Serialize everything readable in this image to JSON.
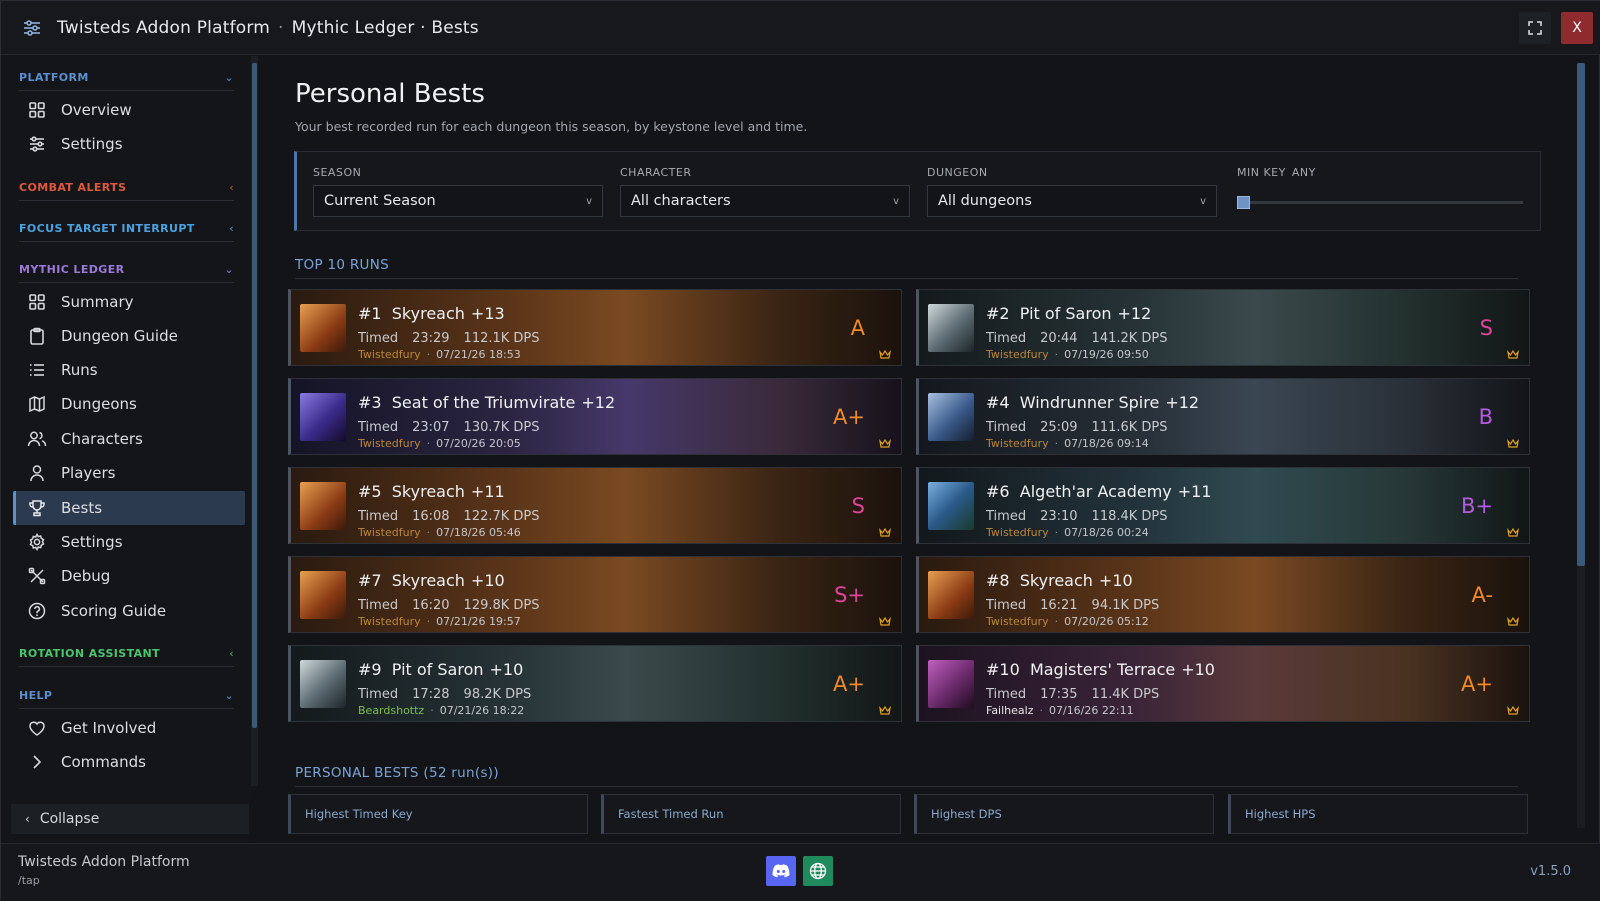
{
  "window": {
    "app_title": "Twisteds Addon Platform",
    "separator": "·",
    "section_title": "Mythic Ledger · Bests",
    "close_label": "X"
  },
  "sidebar": {
    "sections": [
      {
        "label": "PLATFORM",
        "color": "#5b8fcf",
        "expanded": true,
        "items": [
          "Overview",
          "Settings"
        ]
      },
      {
        "label": "COMBAT ALERTS",
        "color": "#e0583b",
        "expanded": false
      },
      {
        "label": "FOCUS TARGET INTERRUPT",
        "color": "#4aa3e0",
        "expanded": false
      },
      {
        "label": "MYTHIC LEDGER",
        "color": "#9b7ad8",
        "expanded": true,
        "items": [
          "Summary",
          "Dungeon Guide",
          "Runs",
          "Dungeons",
          "Characters",
          "Players",
          "Bests",
          "Settings",
          "Debug",
          "Scoring Guide"
        ]
      },
      {
        "label": "ROTATION ASSISTANT",
        "color": "#4cc46d",
        "expanded": false
      },
      {
        "label": "HELP",
        "color": "#5b8fcf",
        "expanded": true,
        "items": [
          "Get Involved",
          "Commands"
        ]
      }
    ],
    "active_item": "Bests",
    "collapse_label": "Collapse"
  },
  "page": {
    "title": "Personal Bests",
    "subtitle": "Your best recorded run for each dungeon this season, by keystone level and time."
  },
  "filters": {
    "season": {
      "label": "SEASON",
      "value": "Current Season"
    },
    "character": {
      "label": "CHARACTER",
      "value": "All characters"
    },
    "dungeon": {
      "label": "DUNGEON",
      "value": "All dungeons"
    },
    "min_key": {
      "label": "MIN KEY",
      "value": "ANY",
      "level": 0
    }
  },
  "top_runs": {
    "heading": "TOP 10 RUNS",
    "runs": [
      {
        "rank": "#1",
        "dungeon": "Skyreach",
        "level": "+13",
        "status": "Timed",
        "time": "23:29",
        "dps": "112.1K DPS",
        "player": "Twistedfury",
        "date": "07/21/26 18:53",
        "grade": "A",
        "grade_color": "#f08a2c",
        "theme": "skyreach"
      },
      {
        "rank": "#2",
        "dungeon": "Pit of Saron",
        "level": "+12",
        "status": "Timed",
        "time": "20:44",
        "dps": "141.2K DPS",
        "player": "Twistedfury",
        "date": "07/19/26 09:50",
        "grade": "S",
        "grade_color": "#e0449a",
        "theme": "saron"
      },
      {
        "rank": "#3",
        "dungeon": "Seat of the Triumvirate",
        "level": "+12",
        "status": "Timed",
        "time": "23:07",
        "dps": "130.7K DPS",
        "player": "Twistedfury",
        "date": "07/20/26 20:05",
        "grade": "A+",
        "grade_color": "#f08a2c",
        "theme": "seat"
      },
      {
        "rank": "#4",
        "dungeon": "Windrunner Spire",
        "level": "+12",
        "status": "Timed",
        "time": "25:09",
        "dps": "111.6K DPS",
        "player": "Twistedfury",
        "date": "07/18/26 09:14",
        "grade": "B",
        "grade_color": "#b45be0",
        "theme": "windrunner"
      },
      {
        "rank": "#5",
        "dungeon": "Skyreach",
        "level": "+11",
        "status": "Timed",
        "time": "16:08",
        "dps": "122.7K DPS",
        "player": "Twistedfury",
        "date": "07/18/26 05:46",
        "grade": "S",
        "grade_color": "#e0449a",
        "theme": "skyreach"
      },
      {
        "rank": "#6",
        "dungeon": "Algeth'ar Academy",
        "level": "+11",
        "status": "Timed",
        "time": "23:10",
        "dps": "118.4K DPS",
        "player": "Twistedfury",
        "date": "07/18/26 00:24",
        "grade": "B+",
        "grade_color": "#b45be0",
        "theme": "academy"
      },
      {
        "rank": "#7",
        "dungeon": "Skyreach",
        "level": "+10",
        "status": "Timed",
        "time": "16:20",
        "dps": "129.8K DPS",
        "player": "Twistedfury",
        "date": "07/21/26 19:57",
        "grade": "S+",
        "grade_color": "#e0449a",
        "theme": "skyreach"
      },
      {
        "rank": "#8",
        "dungeon": "Skyreach",
        "level": "+10",
        "status": "Timed",
        "time": "16:21",
        "dps": "94.1K DPS",
        "player": "Twistedfury",
        "date": "07/20/26 05:12",
        "grade": "A-",
        "grade_color": "#f08a2c",
        "theme": "skyreach"
      },
      {
        "rank": "#9",
        "dungeon": "Pit of Saron",
        "level": "+10",
        "status": "Timed",
        "time": "17:28",
        "dps": "98.2K DPS",
        "player": "Beardshottz",
        "date": "07/21/26 18:22",
        "grade": "A+",
        "grade_color": "#f08a2c",
        "theme": "saron"
      },
      {
        "rank": "#10",
        "dungeon": "Magisters' Terrace",
        "level": "+10",
        "status": "Timed",
        "time": "17:35",
        "dps": "11.4K DPS",
        "player": "Failhealz",
        "date": "07/16/26 22:11",
        "grade": "A+",
        "grade_color": "#f08a2c",
        "theme": "magisters"
      }
    ]
  },
  "personal_bests": {
    "heading": "PERSONAL BESTS",
    "count_label": "(52 run(s))",
    "stats": [
      "Highest Timed Key",
      "Fastest Timed Run",
      "Highest DPS",
      "Highest HPS"
    ]
  },
  "footer": {
    "name": "Twisteds Addon Platform",
    "command": "/tap",
    "version": "v1.5.0",
    "discord_color": "#5865f2",
    "web_color": "#1f8a5c"
  },
  "icons": {
    "player_colors": {
      "Twistedfury": "#b9853a",
      "Beardshottz": "#7cc04a",
      "Failhealz": "#e6e6e6"
    }
  }
}
